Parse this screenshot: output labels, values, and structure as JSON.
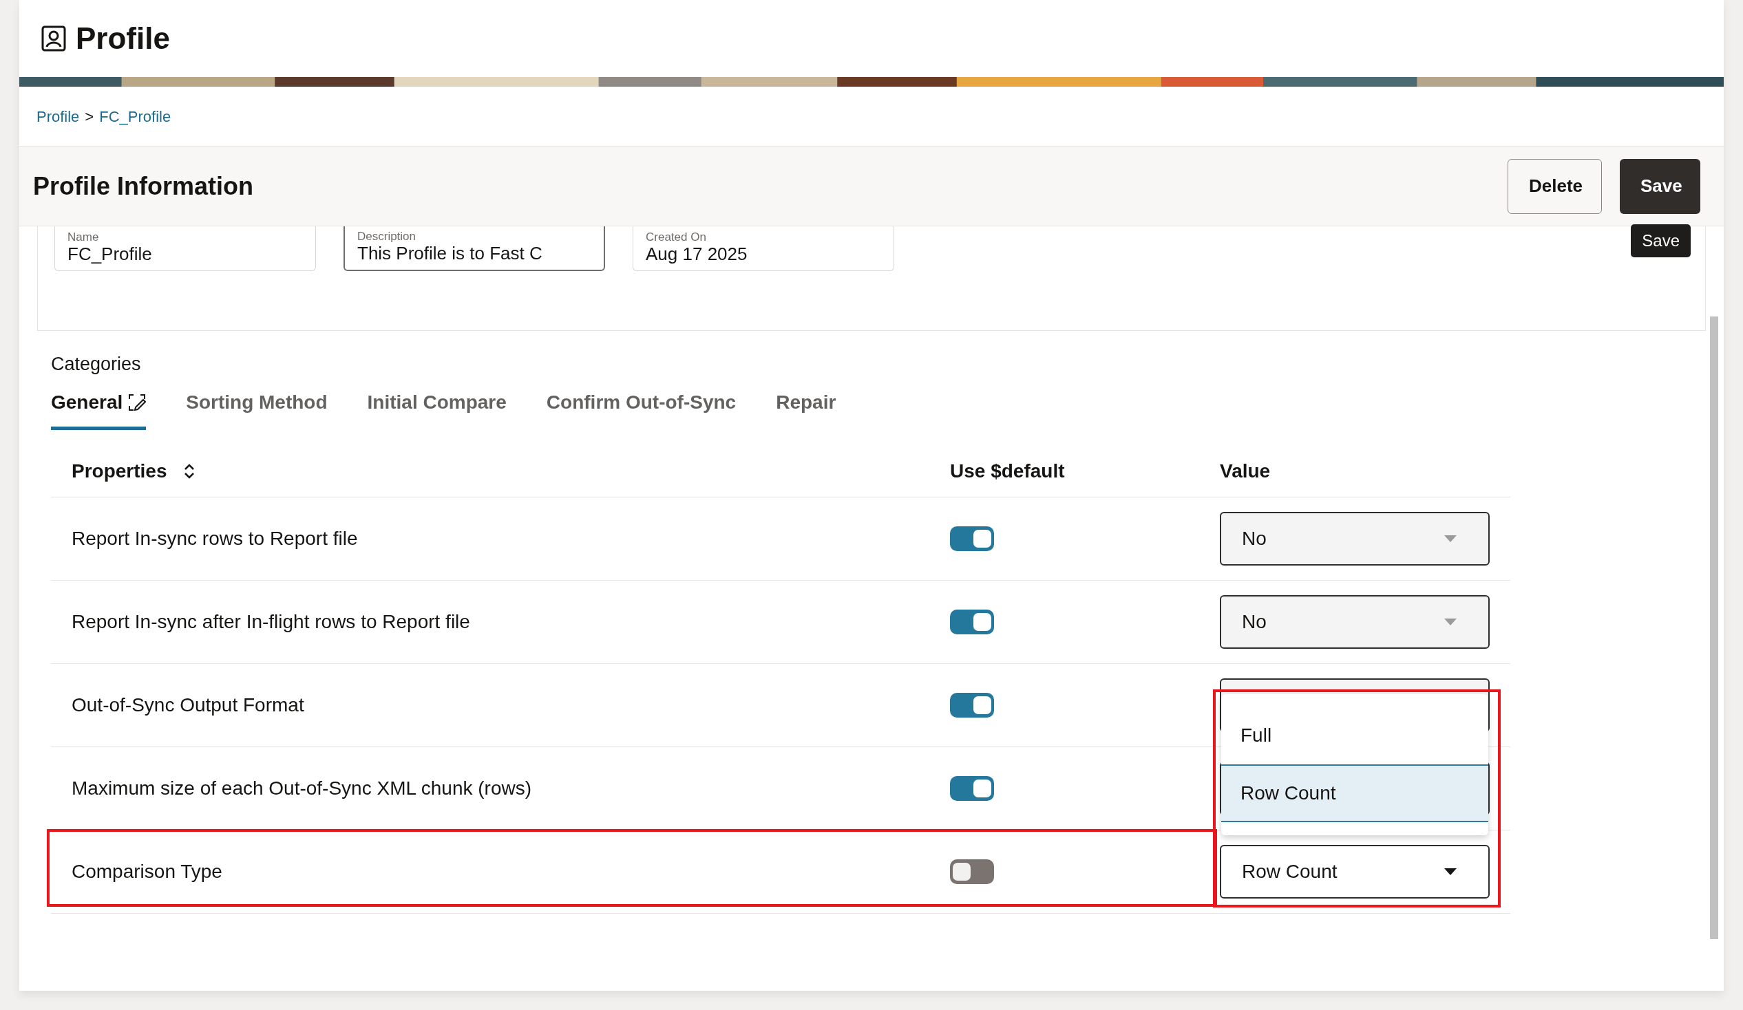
{
  "page": {
    "title": "Profile"
  },
  "breadcrumb": [
    {
      "label": "Profile",
      "link": true
    },
    {
      "label": ">",
      "link": false
    },
    {
      "label": "FC_Profile",
      "link": true
    }
  ],
  "section": {
    "title": "Profile Information",
    "buttons": [
      {
        "label": "Delete",
        "kind": "secondary"
      },
      {
        "label": "Save",
        "kind": "primary"
      }
    ],
    "tooltip": "Save"
  },
  "fields": [
    {
      "label": "Name",
      "value": "FC_Profile",
      "focused": false
    },
    {
      "label": "Description",
      "value": "This Profile is to Fast C",
      "focused": true
    },
    {
      "label": "Created On",
      "value": "Aug 17 2025",
      "focused": false
    }
  ],
  "categories": {
    "label": "Categories",
    "tabs": [
      {
        "label": "General",
        "selected": true,
        "edit_icon": true
      },
      {
        "label": "Sorting Method",
        "selected": false,
        "edit_icon": false
      },
      {
        "label": "Initial Compare",
        "selected": false,
        "edit_icon": false
      },
      {
        "label": "Confirm Out-of-Sync",
        "selected": false,
        "edit_icon": false
      },
      {
        "label": "Repair",
        "selected": false,
        "edit_icon": false
      }
    ]
  },
  "table": {
    "columns": [
      "Properties",
      "Use $default",
      "Value"
    ],
    "rows": [
      {
        "property": "Report In-sync rows to Report file",
        "use_default": true,
        "value": "No",
        "disabled": true,
        "highlighted": false
      },
      {
        "property": "Report In-sync after In-flight rows to Report file",
        "use_default": true,
        "value": "No",
        "disabled": true,
        "highlighted": false
      },
      {
        "property": "Out-of-Sync Output Format",
        "use_default": true,
        "disabled": true,
        "highlighted": false
      },
      {
        "property": "Maximum size of each Out-of-Sync XML chunk (rows)",
        "use_default": true,
        "disabled": true,
        "highlighted": false
      },
      {
        "property": "Comparison Type",
        "use_default": false,
        "value": "Row Count",
        "disabled": false,
        "highlighted": true,
        "menu": [
          {
            "label": "Full",
            "selected": false
          },
          {
            "label": "Row Count",
            "selected": true
          }
        ]
      }
    ]
  }
}
